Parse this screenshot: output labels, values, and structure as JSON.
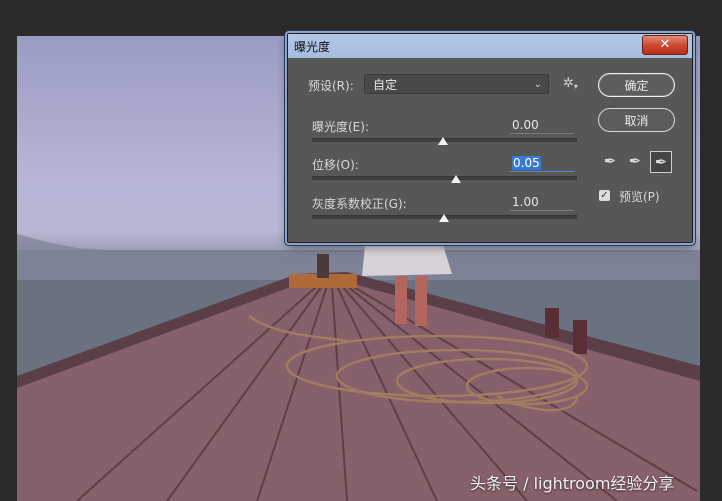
{
  "dialog": {
    "title": "曝光度",
    "close_label": "✕",
    "preset_label": "预设(R):",
    "preset_value": "自定",
    "settings_icon": "gear-icon",
    "exposure_label": "曝光度(E):",
    "exposure_value": "0.00",
    "offset_label": "位移(O):",
    "offset_value": "0.05",
    "gamma_label": "灰度系数校正(G):",
    "gamma_value": "1.00",
    "ok_label": "确定",
    "cancel_label": "取消",
    "preview_label": "预览(P)",
    "preview_checked": true
  },
  "watermark": "头条号 / lightroom经验分享"
}
